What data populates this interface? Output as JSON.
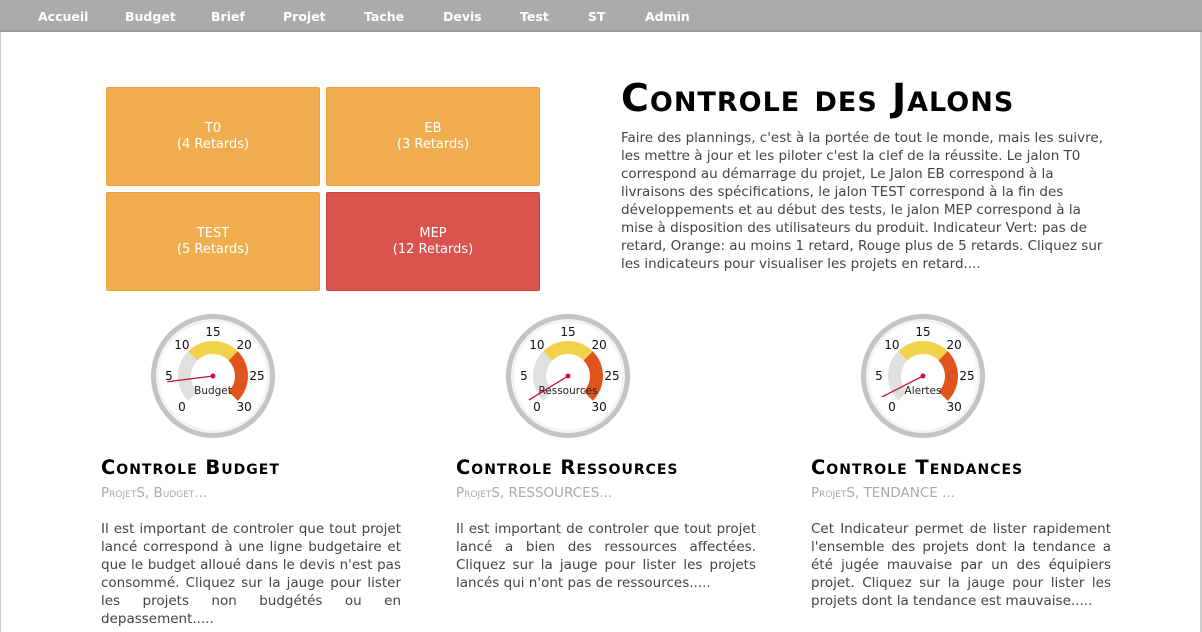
{
  "nav": {
    "items": [
      {
        "label": "Accueil"
      },
      {
        "label": "Budget"
      },
      {
        "label": "Brief"
      },
      {
        "label": "Projet"
      },
      {
        "label": "Tache"
      },
      {
        "label": "Devis"
      },
      {
        "label": "Test"
      },
      {
        "label": "ST"
      },
      {
        "label": "Admin"
      }
    ]
  },
  "jalons": {
    "tiles": [
      {
        "name": "T0",
        "retards": "(4 Retards)",
        "status": "orange"
      },
      {
        "name": "EB",
        "retards": "(3 Retards)",
        "status": "orange"
      },
      {
        "name": "TEST",
        "retards": "(5 Retards)",
        "status": "orange"
      },
      {
        "name": "MEP",
        "retards": "(12 Retards)",
        "status": "red"
      }
    ],
    "title": "Controle des Jalons",
    "intro": "Faire des plannings, c'est à la portée de tout le monde, mais les suivre, les mettre à jour et les piloter c'est la clef de la réussite. Le jalon T0 correspond au démarrage du projet, Le Jalon EB correspond à la livraisons des spécifications, le jalon TEST correspond à la fin des développements et au début des tests, le jalon MEP correspond à la mise à disposition des utilisateurs du produit. Indicateur Vert: pas de retard, Orange: au moins 1 retard, Rouge plus de 5 retards. Cliquez sur les indicateurs pour visualiser les projets en retard...."
  },
  "colors": {
    "orange": "#f0ad4e",
    "red": "#d9534f",
    "gauge_yellow": "#f2d24b",
    "gauge_orange": "#e0531c",
    "gauge_grey": "#e0e0e0",
    "needle": "#c8103a"
  },
  "gauges": [
    {
      "label": "Budget",
      "value": 4.2,
      "min": 0,
      "max": 30,
      "ticks": [
        "0",
        "5",
        "10",
        "15",
        "20",
        "25",
        "30"
      ]
    },
    {
      "label": "Ressources",
      "value": 1.5,
      "min": 0,
      "max": 30,
      "ticks": [
        "0",
        "5",
        "10",
        "15",
        "20",
        "25",
        "30"
      ]
    },
    {
      "label": "Alertes",
      "value": 2.0,
      "min": 0,
      "max": 30,
      "ticks": [
        "0",
        "5",
        "10",
        "15",
        "20",
        "25",
        "30"
      ]
    }
  ],
  "sections": [
    {
      "title": "Controle Budget",
      "subtitle": "ProjetS, Budget...",
      "text": "Il est important de controler que tout projet lancé correspond à une ligne budgetaire et que le budget alloué dans le devis n'est pas consommé. Cliquez sur la jauge pour lister les projets non budgétés ou en depassement....."
    },
    {
      "title": "Controle Ressources",
      "subtitle": "ProjetS, RESSOURCES...",
      "text": "Il est important de controler que tout projet lancé a bien des ressources affectées. Cliquez sur la jauge pour lister les projets lancés qui n'ont pas de ressources....."
    },
    {
      "title": "Controle Tendances",
      "subtitle": "ProjetS, TENDANCE ...",
      "text": "Cet Indicateur permet de lister rapidement l'ensemble des projets dont la tendance a été jugée mauvaise par un des équipiers projet. Cliquez sur la jauge pour lister les projets dont la tendance est mauvaise....."
    }
  ]
}
